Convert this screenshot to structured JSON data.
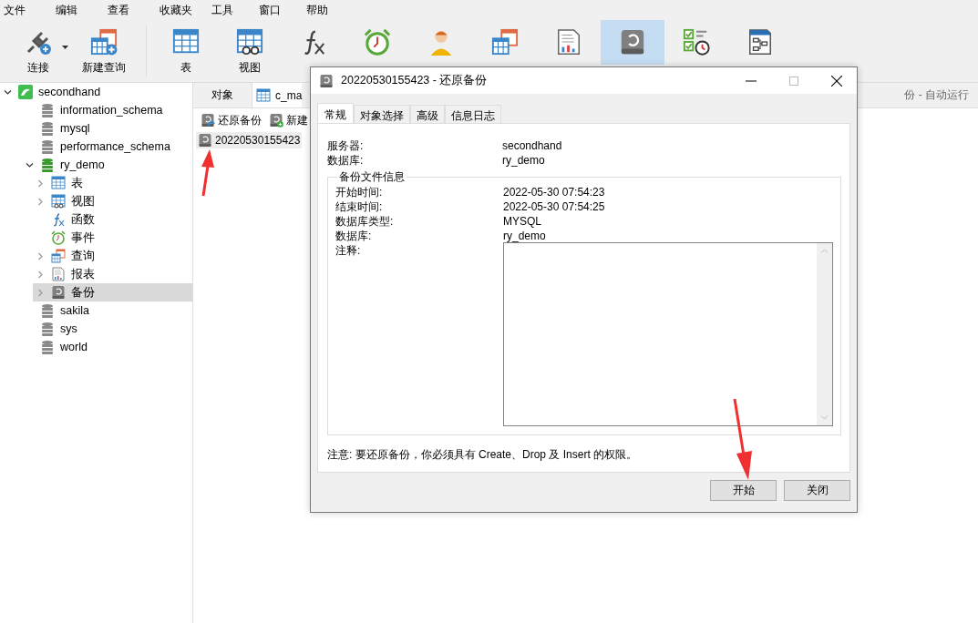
{
  "menu": [
    "文件",
    "编辑",
    "查看",
    "收藏夹",
    "工具",
    "窗口",
    "帮助"
  ],
  "toolbar": [
    {
      "kind": "connection",
      "label": "连接",
      "dropdown": true,
      "selected": false
    },
    {
      "kind": "new-query",
      "label": "新建查询",
      "selected": false
    },
    {
      "kind": "table",
      "label": "表",
      "selected": false
    },
    {
      "kind": "view",
      "label": "视图",
      "selected": false
    },
    {
      "kind": "function",
      "selected": false
    },
    {
      "kind": "event",
      "selected": false
    },
    {
      "kind": "user",
      "selected": false
    },
    {
      "kind": "query",
      "selected": false
    },
    {
      "kind": "report",
      "selected": false
    },
    {
      "kind": "backup",
      "selected": true
    },
    {
      "kind": "automation",
      "selected": false
    },
    {
      "kind": "model",
      "selected": false
    }
  ],
  "tree": [
    {
      "kind": "connection",
      "label": "secondhand",
      "expanded": true,
      "selected": false,
      "children": [
        {
          "kind": "database",
          "label": "information_schema",
          "selected": false
        },
        {
          "kind": "database",
          "label": "mysql",
          "selected": false
        },
        {
          "kind": "database",
          "label": "performance_schema",
          "selected": false
        },
        {
          "kind": "database-open",
          "label": "ry_demo",
          "expanded": true,
          "selected": false,
          "children": [
            {
              "kind": "table",
              "label": "表",
              "expanded": false,
              "selected": false
            },
            {
              "kind": "view",
              "label": "视图",
              "expanded": false,
              "selected": false
            },
            {
              "kind": "function",
              "label": "函数",
              "selected": false
            },
            {
              "kind": "event",
              "label": "事件",
              "selected": false
            },
            {
              "kind": "query",
              "label": "查询",
              "expanded": false,
              "selected": false
            },
            {
              "kind": "report",
              "label": "报表",
              "expanded": false,
              "selected": false
            },
            {
              "kind": "backup",
              "label": "备份",
              "expanded": false,
              "selected": true
            }
          ]
        },
        {
          "kind": "database",
          "label": "sakila",
          "selected": false
        },
        {
          "kind": "database",
          "label": "sys",
          "selected": false
        },
        {
          "kind": "database",
          "label": "world",
          "selected": false
        }
      ]
    }
  ],
  "tabs": [
    {
      "label": "对象",
      "selected": true
    },
    {
      "label": "c_ma",
      "selected": false
    }
  ],
  "tab_strip_right_text": "份 - 自动运行",
  "object_toolbar": [
    {
      "kind": "restore",
      "label": "还原备份"
    },
    {
      "kind": "new",
      "label": "新建"
    }
  ],
  "objects": [
    {
      "label": "20220530155423",
      "selected": true
    }
  ],
  "dialog": {
    "title": "20220530155423 - 还原备份",
    "tabs": [
      {
        "label": "常规",
        "selected": true
      },
      {
        "label": "对象选择",
        "selected": false
      },
      {
        "label": "高级",
        "selected": false
      },
      {
        "label": "信息日志",
        "selected": false
      }
    ],
    "fields": [
      {
        "label": "服务器:",
        "value": "secondhand"
      },
      {
        "label": "数据库:",
        "value": "ry_demo"
      }
    ],
    "group": {
      "title": "备份文件信息",
      "fields": [
        {
          "label": "开始时间:",
          "value": "2022-05-30 07:54:23"
        },
        {
          "label": "结束时间:",
          "value": "2022-05-30 07:54:25"
        },
        {
          "label": "数据库类型:",
          "value": "MYSQL"
        },
        {
          "label": "数据库:",
          "value": "ry_demo"
        }
      ],
      "comment_label": "注释:"
    },
    "note": "注意: 要还原备份，你必须具有 Create、Drop 及 Insert 的权限。",
    "buttons": [
      "开始",
      "关闭"
    ]
  }
}
